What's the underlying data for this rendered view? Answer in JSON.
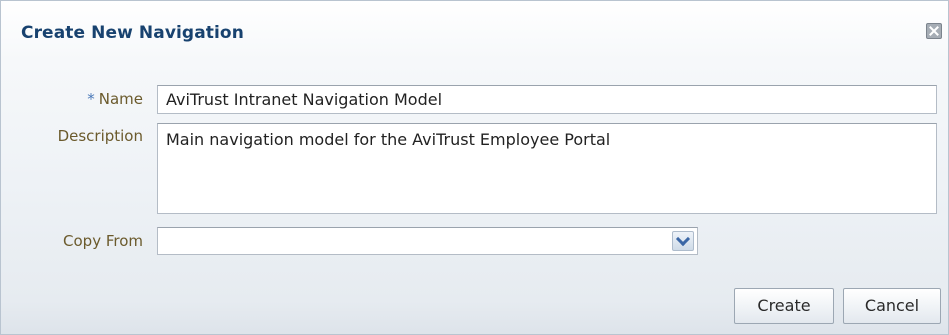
{
  "dialog": {
    "title": "Create New Navigation",
    "close_icon": "close-icon"
  },
  "form": {
    "name": {
      "required_marker": "*",
      "label": "Name",
      "value": "AviTrust Intranet Navigation Model"
    },
    "description": {
      "label": "Description",
      "value": "Main navigation model for the AviTrust Employee Portal"
    },
    "copy_from": {
      "label": "Copy From",
      "value": "",
      "dropdown_icon": "chevron-down-icon"
    }
  },
  "actions": {
    "create_label": "Create",
    "cancel_label": "Cancel"
  }
}
